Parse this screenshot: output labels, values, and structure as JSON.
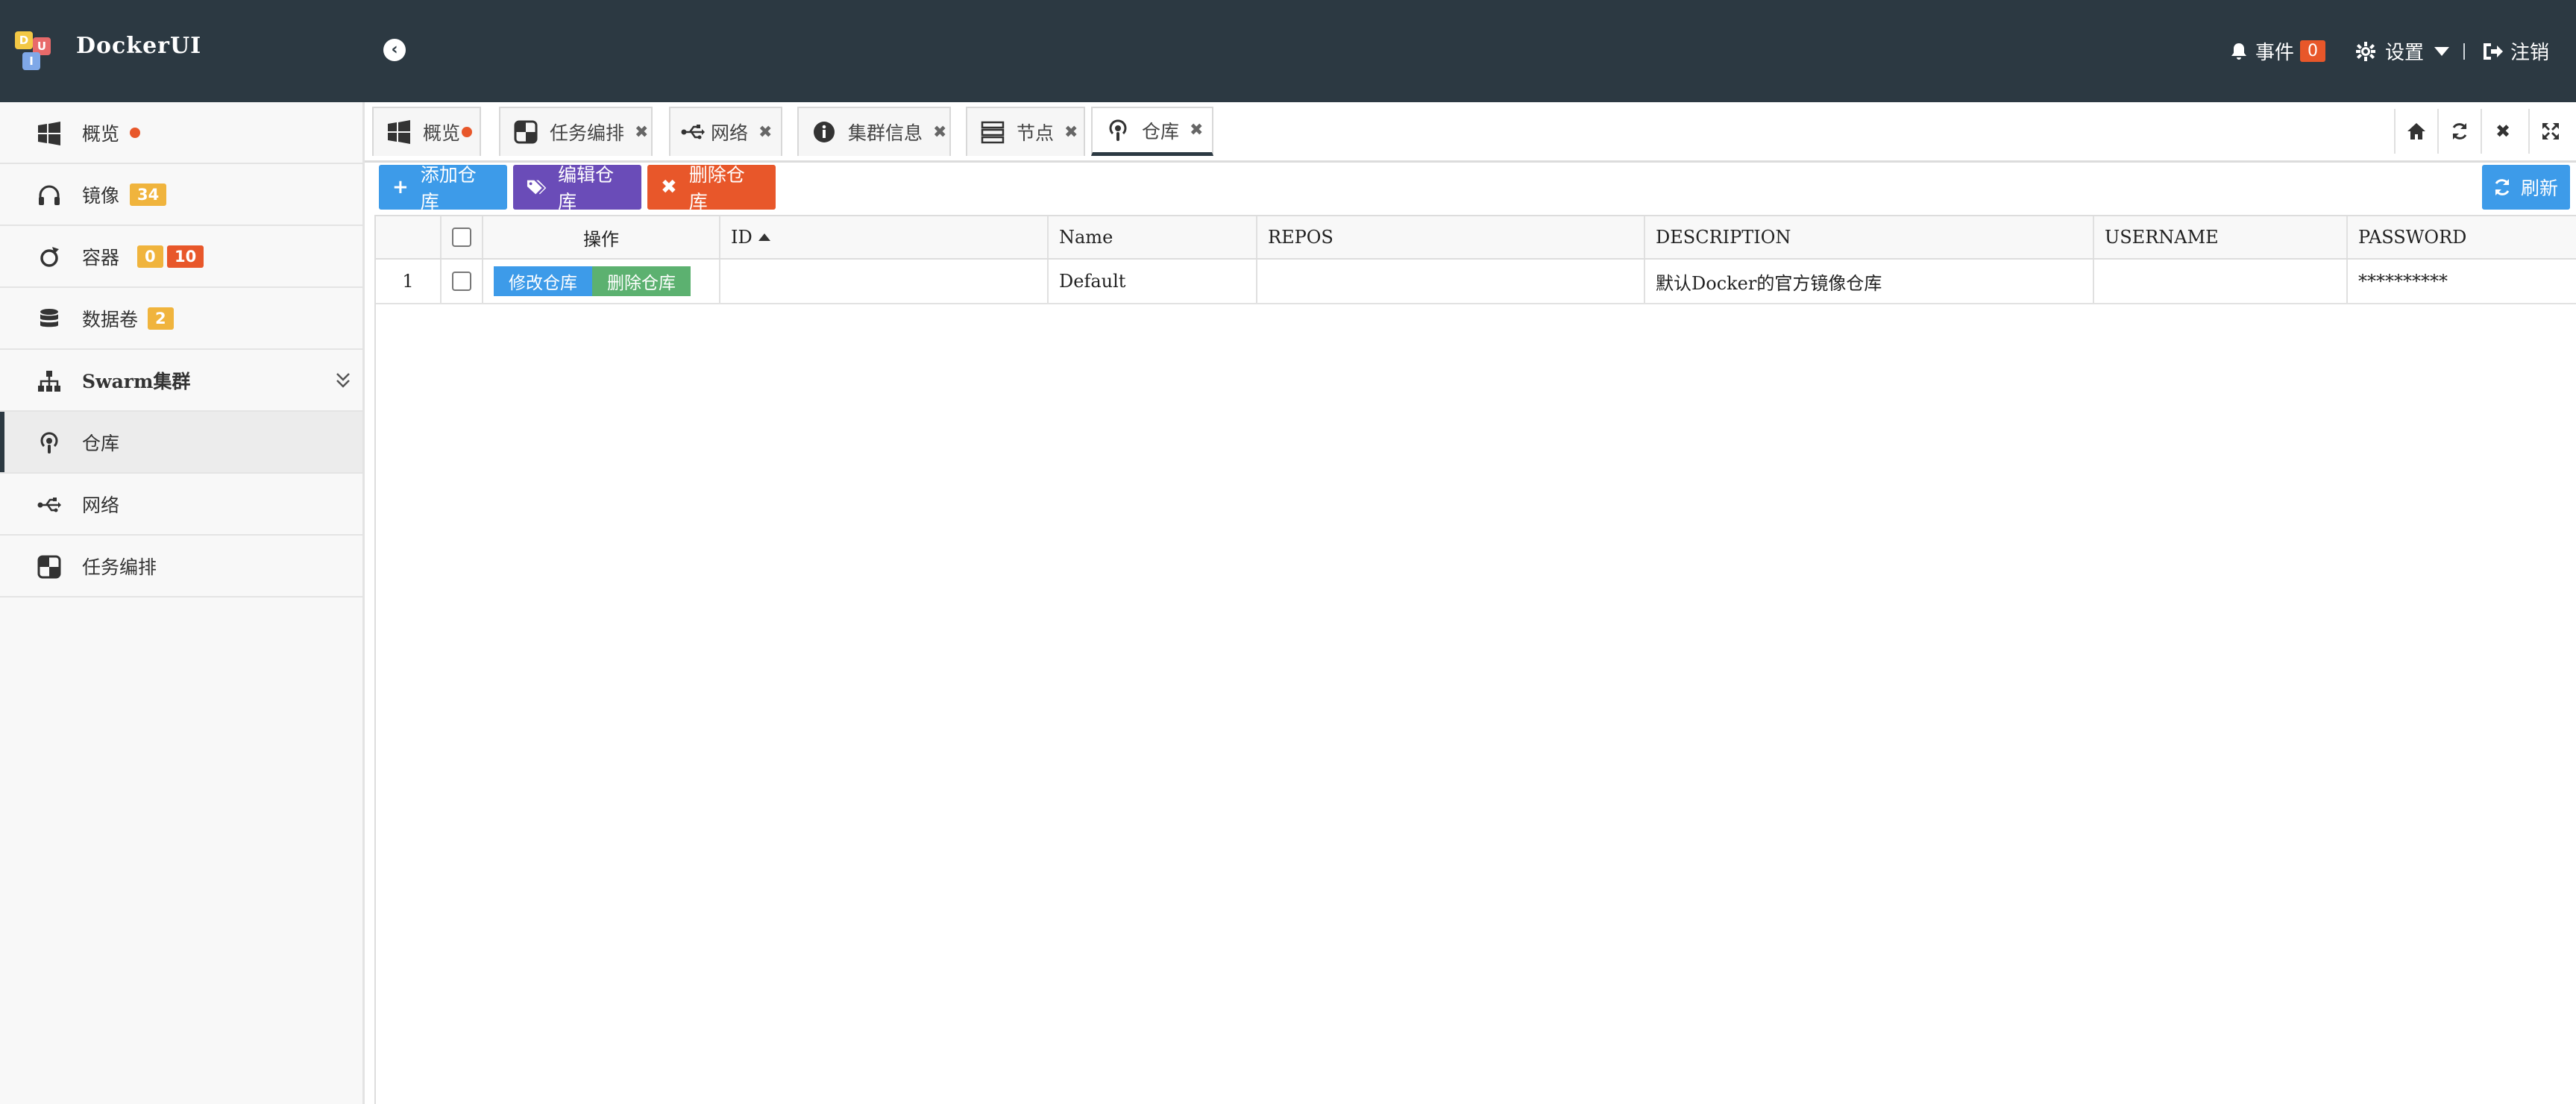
{
  "header": {
    "brand": "DockerUI",
    "events_label": "事件",
    "events_count": "0",
    "settings_label": "设置",
    "logout_label": "注销"
  },
  "sidebar": {
    "items": [
      {
        "label": "概览",
        "icon": "windows-icon"
      },
      {
        "label": "镜像",
        "icon": "headphones-icon",
        "badge": "34"
      },
      {
        "label": "容器",
        "icon": "refresh-ring-icon",
        "badge1": "0",
        "badge2": "10"
      },
      {
        "label": "数据卷",
        "icon": "database-icon",
        "badge": "2"
      },
      {
        "label": "Swarm集群",
        "icon": "sitemap-icon"
      },
      {
        "label": "仓库",
        "icon": "podcast-icon",
        "active": true
      },
      {
        "label": "网络",
        "icon": "usb-icon"
      },
      {
        "label": "任务编排",
        "icon": "orchestration-icon"
      }
    ]
  },
  "tabs": [
    {
      "label": "概览",
      "icon": "windows-icon"
    },
    {
      "label": "任务编排",
      "icon": "orchestration-icon"
    },
    {
      "label": "网络",
      "icon": "usb-icon"
    },
    {
      "label": "集群信息",
      "icon": "info-icon"
    },
    {
      "label": "节点",
      "icon": "server-icon"
    },
    {
      "label": "仓库",
      "icon": "podcast-icon",
      "active": true
    }
  ],
  "toolbar": {
    "add_label": "添加仓库",
    "edit_label": "编辑仓库",
    "delete_label": "删除仓库",
    "refresh_label": "刷新"
  },
  "table": {
    "columns": [
      "操作",
      "ID",
      "Name",
      "REPOS",
      "DESCRIPTION",
      "USERNAME",
      "PASSWORD"
    ],
    "sort_column": "ID",
    "rows": [
      {
        "index": "1",
        "edit_action": "修改仓库",
        "delete_action": "删除仓库",
        "id": "",
        "name": "Default",
        "repos": "",
        "description": "默认Docker的官方镜像仓库",
        "username": "",
        "password": "**********"
      }
    ]
  },
  "colors": {
    "header_bg": "#2c3942",
    "add_btn": "#3d9be9",
    "edit_btn": "#6a4cb8",
    "delete_btn": "#e8572a",
    "row_edit_btn": "#3d9be9",
    "row_delete_btn": "#5cb170",
    "badge_yellow": "#f0b43d",
    "badge_red": "#e8572a"
  }
}
